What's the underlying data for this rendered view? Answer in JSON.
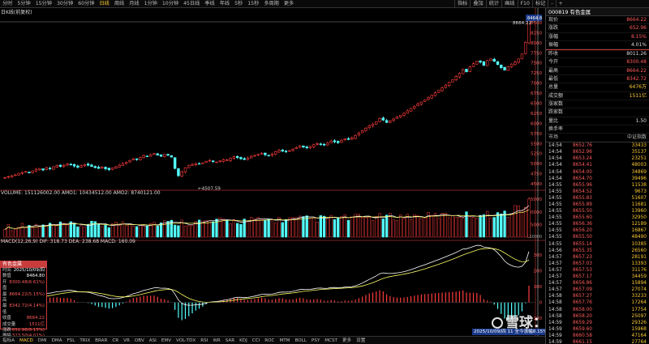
{
  "toolbar": {
    "periods": [
      "分时",
      "5分钟",
      "15分钟",
      "30分钟",
      "60分钟",
      "日线",
      "周线",
      "月线",
      "1分钟",
      "10分钟",
      "45日线",
      "季线",
      "年线",
      "5秒",
      "15秒",
      "多周期",
      "更多"
    ],
    "active_period": 5,
    "tools": [
      "指标",
      "叠加",
      "统计",
      "画线",
      "F10",
      "标记",
      "-",
      "+"
    ]
  },
  "price_pane": {
    "label": "日K线(前复权)",
    "axis_ticks": [
      "8500",
      "8250",
      "8000",
      "7750",
      "7500",
      "7250",
      "7000",
      "6750",
      "6500",
      "6250",
      "6000",
      "5750",
      "5500",
      "5250",
      "5000",
      "4750",
      "4500"
    ],
    "high_label": "8664.22",
    "low_label": "4507.59",
    "current_tag": "8464.8"
  },
  "volume_pane": {
    "title": "VOLUME: 151126002.00  AMO1: 10434512.00  AMO2: 8740121.00",
    "axis_ticks": [
      "15000",
      "10000",
      "5000"
    ],
    "unit": "X10000"
  },
  "macd_pane": {
    "title": "MACD(12,26,9)  DIF: 318.73  DEA: 238.68  MACD: 160.09",
    "axis_ticks": [
      "300",
      "200",
      "100",
      "0",
      "-100"
    ]
  },
  "quote_box": {
    "title": "有色金属",
    "rows": [
      {
        "k": "时间",
        "v": "2025/10/09/四"
      },
      {
        "k": "数值",
        "v": "8464.80"
      },
      {
        "k": "开盘",
        "v": "8300.48(6.61%)"
      },
      {
        "k": "最高",
        "v": "8664.22(5.15%)"
      },
      {
        "k": "最低",
        "v": "8342.72(4.14%)"
      },
      {
        "k": "收盘",
        "v": "8664.22"
      },
      {
        "k": "成交量",
        "v": "1511亿"
      },
      {
        "k": "涨跌",
        "v": "652.96(8.15%)"
      },
      {
        "k": "振幅",
        "v": "323.50(4.01%)"
      }
    ]
  },
  "bottom_tabs": [
    "指标A",
    "MACD",
    "DMI",
    "DMA",
    "FSL",
    "TRIX",
    "BRAR",
    "CR",
    "VR",
    "OBV",
    "ASI",
    "EMV",
    "VOL-TDX",
    "RSI",
    "WR",
    "SAR",
    "KDJ",
    "CCI",
    "ROC",
    "MTM",
    "BOLL",
    "PSY",
    "MCST",
    "更多",
    "设置"
  ],
  "date_hint": "2025/10/09/四 11 全今涨幅8.15%",
  "watermark": "雪球：Syedc",
  "right_panel": {
    "title": "000819 有色金属",
    "stats": [
      {
        "k": "现价",
        "v": "8664.22",
        "c": "r"
      },
      {
        "k": "涨跌",
        "v": "652.96",
        "c": "r"
      },
      {
        "k": "涨幅",
        "v": "8.15%",
        "c": "r"
      },
      {
        "k": "振幅",
        "v": "4.01%",
        "c": "w"
      },
      {
        "k": "昨收",
        "v": "8011.26",
        "c": "w"
      },
      {
        "k": "今开",
        "v": "8300.48",
        "c": "r"
      },
      {
        "k": "最高",
        "v": "8664.22",
        "c": "r"
      },
      {
        "k": "最低",
        "v": "8342.72",
        "c": "r"
      },
      {
        "k": "总量",
        "v": "6476万",
        "c": "c"
      },
      {
        "k": "成交额",
        "v": "1511亿",
        "c": "c"
      },
      {
        "k": "涨家数",
        "v": "",
        "c": "w"
      },
      {
        "k": "跌家数",
        "v": "",
        "c": "w"
      },
      {
        "k": "量比",
        "v": "1.50",
        "c": "w"
      },
      {
        "k": "换手率",
        "v": "",
        "c": "w"
      }
    ],
    "tick_header": {
      "left": "市场",
      "right": "中证指数"
    },
    "ticks": [
      {
        "t": "14:54",
        "p": "8652.76",
        "v": "33433"
      },
      {
        "t": "14:54",
        "p": "8652.96",
        "v": "35137"
      },
      {
        "t": "14:54",
        "p": "8653.24",
        "v": "23251"
      },
      {
        "t": "14:54",
        "p": "8654.41",
        "v": "48003"
      },
      {
        "t": "14:54",
        "p": "8654.00",
        "v": "34869"
      },
      {
        "t": "14:54",
        "p": "8654.70",
        "v": "39496"
      },
      {
        "t": "14:55",
        "p": "8655.96",
        "v": "11538"
      },
      {
        "t": "14:55",
        "p": "8654.52",
        "v": "9673"
      },
      {
        "t": "14:55",
        "p": "8655.83",
        "v": "51607"
      },
      {
        "t": "14:55",
        "p": "8655.89",
        "v": "11681"
      },
      {
        "t": "14:55",
        "p": "8655.50",
        "v": "13960"
      },
      {
        "t": "14:55",
        "p": "8655.60",
        "v": "32950"
      },
      {
        "t": "14:55",
        "p": "8656.36",
        "v": "12189"
      },
      {
        "t": "14:55",
        "p": "8656.20",
        "v": "16867"
      },
      {
        "t": "14:55",
        "p": "8655.50",
        "v": "48490"
      },
      {
        "t": "14:55",
        "p": "8655.14",
        "v": "10385"
      },
      {
        "t": "14:56",
        "p": "8655.35",
        "v": "26560"
      },
      {
        "t": "14:57",
        "p": "8657.23",
        "v": "28191"
      },
      {
        "t": "14:57",
        "p": "8657.03",
        "v": "13393"
      },
      {
        "t": "14:57",
        "p": "8657.53",
        "v": "31176"
      },
      {
        "t": "14:57",
        "p": "8657.17",
        "v": "34459"
      },
      {
        "t": "14:57",
        "p": "8656.86",
        "v": "15894"
      },
      {
        "t": "14:57",
        "p": "8657.09",
        "v": "27074"
      },
      {
        "t": "14:58",
        "p": "8657.27",
        "v": "33233"
      },
      {
        "t": "14:58",
        "p": "8657.76",
        "v": "17264"
      },
      {
        "t": "14:58",
        "p": "8658.00",
        "v": "17754"
      },
      {
        "t": "14:58",
        "p": "8658.20",
        "v": "25097"
      },
      {
        "t": "14:59",
        "p": "8659.29",
        "p2": "",
        "v": "29326"
      },
      {
        "t": "14:59",
        "p": "8659.60",
        "v": "15968"
      },
      {
        "t": "14:59",
        "p": "8660.58",
        "v": "47164"
      },
      {
        "t": "14:59",
        "p": "8661.15",
        "v": "27764"
      },
      {
        "t": "15:00",
        "p": "8664.22",
        "v": "443834"
      }
    ]
  },
  "chart_data": {
    "type": "candlestick",
    "price_range": [
      4400,
      8700
    ],
    "closes_approx": [
      4650,
      4680,
      4700,
      4720,
      4760,
      4780,
      4800,
      4770,
      4820,
      4860,
      4880,
      4840,
      4900,
      4870,
      4920,
      4950,
      4930,
      4960,
      4990,
      4970,
      4940,
      4910,
      4950,
      4980,
      4960,
      4930,
      4900,
      4880,
      4910,
      4870,
      4850,
      4890,
      4920,
      4960,
      5000,
      5030,
      5080,
      5120,
      5100,
      5150,
      5200,
      5180,
      5220,
      5250,
      5210,
      5180,
      5230,
      5210,
      5160,
      4880,
      4700,
      4800,
      4900,
      4950,
      4980,
      5000,
      4990,
      5020,
      5060,
      5080,
      5050,
      5040,
      5070,
      5100,
      5090,
      5130,
      5170,
      5150,
      5120,
      5100,
      5140,
      5180,
      5200,
      5230,
      5260,
      5220,
      5200,
      5240,
      5300,
      5330,
      5310,
      5290,
      5320,
      5360,
      5400,
      5440,
      5410,
      5390,
      5430,
      5470,
      5500,
      5480,
      5460,
      5510,
      5560,
      5540,
      5520,
      5580,
      5620,
      5600,
      5640,
      5700,
      5760,
      5820,
      5880,
      5940,
      5980,
      6040,
      6120,
      6080,
      6020,
      6060,
      6110,
      6160,
      6200,
      6250,
      6310,
      6370,
      6420,
      6480,
      6530,
      6580,
      6640,
      6700,
      6760,
      6820,
      6880,
      6950,
      7020,
      7080,
      7160,
      7240,
      7330,
      7280,
      7400,
      7480,
      7540,
      7520,
      7440,
      7560,
      7600,
      7540,
      7460,
      7380,
      7320,
      7410,
      7470,
      7520,
      7600,
      7720,
      8010,
      8664
    ],
    "volume_range": [
      0,
      17000
    ],
    "macd_range": [
      -160,
      360
    ]
  }
}
